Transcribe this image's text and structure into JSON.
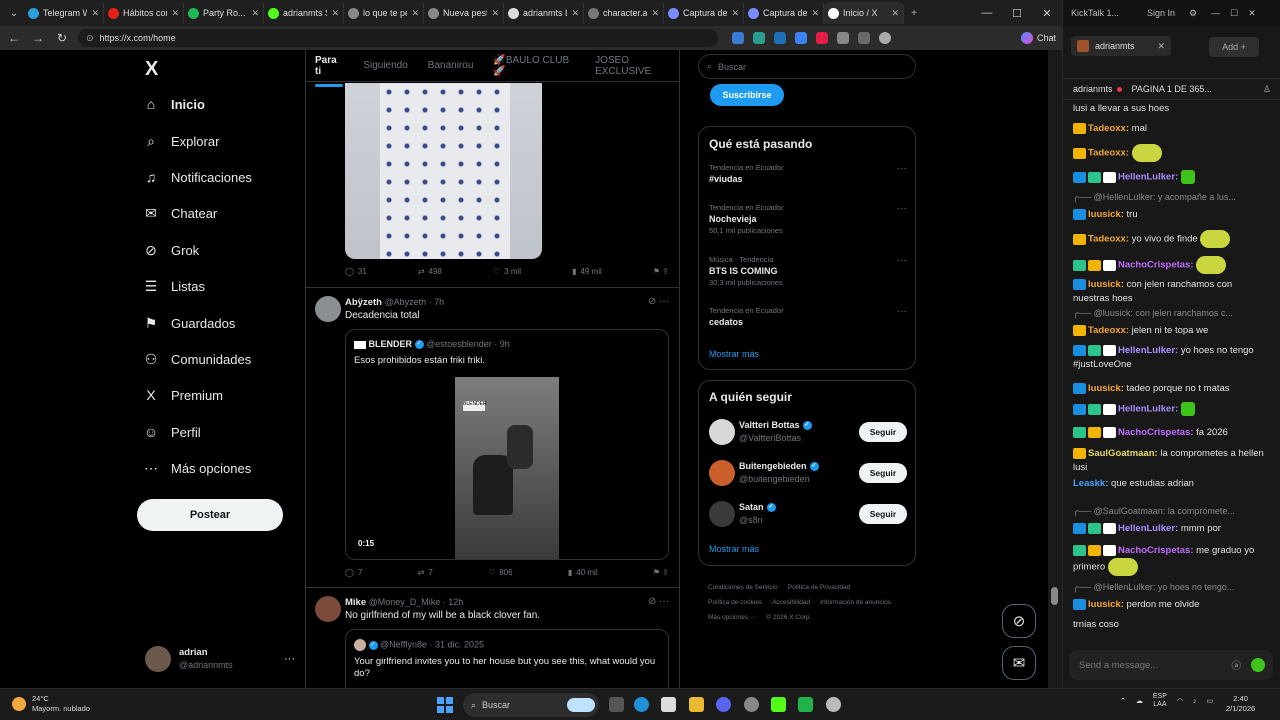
{
  "browser": {
    "tabs": [
      {
        "title": "Telegram Web",
        "color": "#2aa1da"
      },
      {
        "title": "Hábitos con Y...",
        "color": "#e62117"
      },
      {
        "title": "Party Ro...",
        "color": "#1db954"
      },
      {
        "title": "adrianmts Str...",
        "color": "#53fc18"
      },
      {
        "title": "lo que te pe...",
        "color": "#888888"
      },
      {
        "title": "Nueva pestañ...",
        "color": "#888888"
      },
      {
        "title": "adrianmts Le...",
        "color": "#dddddd"
      },
      {
        "title": "character.ai |...",
        "color": "#777777"
      },
      {
        "title": "Captura de p...",
        "color": "#7b8cff"
      },
      {
        "title": "Captura de p...",
        "color": "#7b8cff"
      },
      {
        "title": "Inicio / X",
        "color": "#ffffff"
      }
    ],
    "url": "https://x.com/home",
    "chat_label": "Chat"
  },
  "x": {
    "logo": "X",
    "nav": [
      {
        "label": "Inicio",
        "icon": "home-icon",
        "glyph": "⌂"
      },
      {
        "label": "Explorar",
        "icon": "search-icon",
        "glyph": "⌕"
      },
      {
        "label": "Notificaciones",
        "icon": "bell-icon",
        "glyph": "♫"
      },
      {
        "label": "Chatear",
        "icon": "mail-icon",
        "glyph": "✉"
      },
      {
        "label": "Grok",
        "icon": "grok-icon",
        "glyph": "⊘"
      },
      {
        "label": "Listas",
        "icon": "list-icon",
        "glyph": "☰"
      },
      {
        "label": "Guardados",
        "icon": "bookmark-icon",
        "glyph": "⚑"
      },
      {
        "label": "Comunidades",
        "icon": "people-icon",
        "glyph": "⚇"
      },
      {
        "label": "Premium",
        "icon": "x-icon",
        "glyph": "X"
      },
      {
        "label": "Perfil",
        "icon": "person-icon",
        "glyph": "☺"
      },
      {
        "label": "Más opciones",
        "icon": "more-icon",
        "glyph": "⋯"
      }
    ],
    "post_button": "Postear",
    "profile": {
      "name": "adrian",
      "handle": "@adriannmts",
      "more": "···"
    },
    "feed_tabs": [
      "Para ti",
      "Siguiendo",
      "Bananirou",
      "🚀BAULO CLUB🚀",
      "JOSEO EXCLUSIVE"
    ],
    "post0_stats": {
      "replies": "31",
      "reposts": "498",
      "likes": "3 mil",
      "views": "49 mil"
    },
    "post1": {
      "name": "Abÿzeth",
      "handle": "@Abyzeth · 7h",
      "text": "Decadencia total",
      "quote": {
        "name": "BLENDER",
        "handle": "@estoesblender · 9h",
        "text": "Esos prohibidos están friki friki.",
        "duration": "0:15"
      },
      "stats": {
        "replies": "7",
        "reposts": "7",
        "likes": "806",
        "views": "40 mil"
      }
    },
    "post2": {
      "name": "Mike",
      "handle": "@Money_D_Mike · 12h",
      "text": "No girlfriend of my will be a black clover fan.",
      "quote": {
        "handle": "@Nefflyn8e · 31 dic. 2025",
        "text": "Your girlfriend invites you to her house but you see this, what would you do?"
      }
    },
    "search_placeholder": "Buscar",
    "subscribe": "Suscribirse",
    "trends_title": "Qué está pasando",
    "trends": [
      {
        "context": "Tendencia en Ecuador",
        "name": "#viudas",
        "count": ""
      },
      {
        "context": "Tendencia en Ecuador",
        "name": "Nochevieja",
        "count": "50,1 mil publicaciones"
      },
      {
        "context": "Música · Tendencia",
        "name": "BTS IS COMING",
        "count": "30,3 mil publicaciones"
      },
      {
        "context": "Tendencia en Ecuador",
        "name": "cedatos",
        "count": ""
      }
    ],
    "show_more": "Mostrar más",
    "follow_title": "A quién seguir",
    "follow": [
      {
        "name": "Valtteri Bottas",
        "handle": "@ValtteriBottas",
        "color": "#d8d8d8"
      },
      {
        "name": "Buitengebieden",
        "handle": "@buitengebieden",
        "color": "#c9602c"
      },
      {
        "name": "Satan",
        "handle": "@s8n",
        "color": "#3a3a3a"
      }
    ],
    "follow_btn": "Seguir",
    "footer": [
      "Condiciones de Servicio",
      "Política de Privacidad",
      "Política de cookies",
      "Accesibilidad",
      "Información de anuncios",
      "Más opciones ···",
      "© 2026 X Corp."
    ]
  },
  "kick": {
    "app": "KickTalk 1...",
    "sign_in": "Sign In",
    "tab": "adrianmts",
    "add": "Add",
    "channel": "adrianmts",
    "pinned": "PAGINA 1 DE 365...",
    "messages": [
      {
        "user": "",
        "text": "lusi a llevar a sus hoes",
        "color": "#e0e0e0"
      },
      {
        "user": "Tadeoxx:",
        "text": "mal",
        "color": "#f2a63a"
      },
      {
        "user": "Tadeoxx:",
        "text": "",
        "color": "#f2a63a"
      },
      {
        "user": "HellenLulker:",
        "text": "",
        "color": "#a88cff"
      },
      {
        "user": "",
        "text": "@HellenLulker: y acompañe a lus...",
        "color": "#888888"
      },
      {
        "user": "luusick:",
        "text": "tru",
        "color": "#f2a63a"
      },
      {
        "user": "Tadeoxx:",
        "text": "yo vivo de finde",
        "color": "#f2a63a"
      },
      {
        "user": "NachoCrispetas:",
        "text": "",
        "color": "#c16bff"
      },
      {
        "user": "luusick:",
        "text": "con jelen ranchamos con nuestras hoes",
        "color": "#f2a63a"
      },
      {
        "user": "",
        "text": "@luusick: con jelen ranchamos c...",
        "color": "#888888"
      },
      {
        "user": "Tadeoxx:",
        "text": "jelen ni te topa we",
        "color": "#f2a63a"
      },
      {
        "user": "HellenLulker:",
        "text": "yo hoes no tengo #justLoveOne",
        "color": "#a88cff"
      },
      {
        "user": "luusick:",
        "text": "tadeo porque no t matas",
        "color": "#f2a63a"
      },
      {
        "user": "HellenLulker:",
        "text": "",
        "color": "#a88cff"
      },
      {
        "user": "NachoCrispetas:",
        "text": "fa 2026",
        "color": "#c16bff"
      },
      {
        "user": "SaulGoatmaan:",
        "text": "la comprometes a hellen lusi",
        "color": "#e6d96b"
      },
      {
        "user": "Leaskk:",
        "text": "que estudias adrian",
        "color": "#4aa3ff"
      },
      {
        "user": "",
        "text": "@SaulGoatmaan: la comprómete...",
        "color": "#888888"
      },
      {
        "user": "HellenLulker:",
        "text": "mmm por",
        "color": "#a88cff"
      },
      {
        "user": "NachoCrispetas:",
        "text": "me graduo yo primero",
        "color": "#c16bff"
      },
      {
        "user": "",
        "text": "@HellenLulker: yo hoes no tengo...",
        "color": "#888888"
      },
      {
        "user": "luusick:",
        "text": "perdon me olvide",
        "color": "#f2a63a"
      },
      {
        "user": "",
        "text": "trnias coso",
        "color": "#e0e0e0"
      }
    ],
    "input_placeholder": "Send a message..."
  },
  "taskbar": {
    "temp": "24°C",
    "weather": "Mayorm. nublado",
    "search": "Buscar",
    "lang1": "ESP",
    "lang2": "LAA",
    "time": "2:40",
    "date": "2/1/2026"
  }
}
